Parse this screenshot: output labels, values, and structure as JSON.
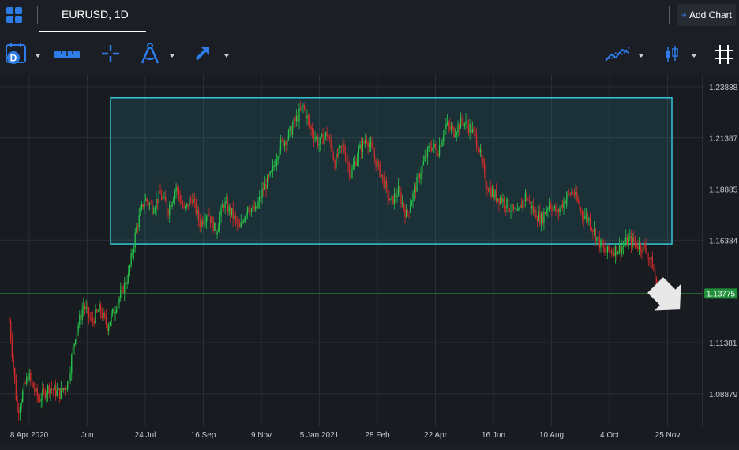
{
  "app": {
    "tab_title": "EURUSD, 1D",
    "add_chart_label": "Add Chart",
    "add_chart_plus": "+"
  },
  "toolbar": {
    "interval_badge": "D",
    "icons": [
      "calendar-interval-icon",
      "ruler-tool-icon",
      "crosshair-icon",
      "drawing-compass-icon",
      "arrow-tool-icon",
      "indicators-icon",
      "candle-type-icon",
      "grid-hash-icon"
    ]
  },
  "colors": {
    "up": "#26c44a",
    "down": "#d62b2b",
    "accent": "#2d7ce8",
    "rectangle": "#35c6d6",
    "price_line": "#2e8b3e",
    "price_label_bg": "#1f8f3a"
  },
  "chart_data": {
    "type": "candlestick",
    "symbol": "EURUSD",
    "interval": "1D",
    "y_ticks": [
      "1.23888",
      "1.21387",
      "1.18885",
      "1.16384",
      "1.13775",
      "1.11381",
      "1.08879"
    ],
    "x_ticks": [
      "8 Apr 2020",
      "Jun",
      "24 Jul",
      "16 Sep",
      "9 Nov",
      "5 Jan 2021",
      "28 Feb",
      "22 Apr",
      "16 Jun",
      "10 Aug",
      "4 Oct",
      "25 Nov"
    ],
    "ylim": [
      1.0729,
      1.2446
    ],
    "current_price": 1.13775,
    "current_price_label": "1.13775",
    "rectangle": {
      "y_top": 1.2335,
      "y_bottom": 1.162
    },
    "anchors": [
      [
        0,
        1.124
      ],
      [
        6,
        1.08
      ],
      [
        14,
        1.098
      ],
      [
        22,
        1.086
      ],
      [
        30,
        1.092
      ],
      [
        38,
        1.089
      ],
      [
        44,
        1.094
      ],
      [
        50,
        1.118
      ],
      [
        56,
        1.132
      ],
      [
        62,
        1.124
      ],
      [
        68,
        1.13
      ],
      [
        74,
        1.122
      ],
      [
        82,
        1.134
      ],
      [
        90,
        1.147
      ],
      [
        96,
        1.17
      ],
      [
        102,
        1.184
      ],
      [
        108,
        1.18
      ],
      [
        114,
        1.186
      ],
      [
        120,
        1.179
      ],
      [
        126,
        1.19
      ],
      [
        132,
        1.178
      ],
      [
        138,
        1.185
      ],
      [
        144,
        1.172
      ],
      [
        150,
        1.178
      ],
      [
        156,
        1.168
      ],
      [
        162,
        1.182
      ],
      [
        168,
        1.177
      ],
      [
        174,
        1.169
      ],
      [
        180,
        1.181
      ],
      [
        186,
        1.178
      ],
      [
        192,
        1.189
      ],
      [
        198,
        1.196
      ],
      [
        204,
        1.21
      ],
      [
        210,
        1.214
      ],
      [
        216,
        1.222
      ],
      [
        222,
        1.229
      ],
      [
        228,
        1.218
      ],
      [
        234,
        1.211
      ],
      [
        240,
        1.216
      ],
      [
        246,
        1.202
      ],
      [
        252,
        1.21
      ],
      [
        258,
        1.196
      ],
      [
        264,
        1.207
      ],
      [
        270,
        1.214
      ],
      [
        276,
        1.204
      ],
      [
        282,
        1.194
      ],
      [
        288,
        1.182
      ],
      [
        294,
        1.188
      ],
      [
        300,
        1.176
      ],
      [
        306,
        1.188
      ],
      [
        312,
        1.2
      ],
      [
        318,
        1.21
      ],
      [
        324,
        1.208
      ],
      [
        330,
        1.22
      ],
      [
        336,
        1.217
      ],
      [
        342,
        1.222
      ],
      [
        348,
        1.219
      ],
      [
        354,
        1.212
      ],
      [
        360,
        1.192
      ],
      [
        366,
        1.186
      ],
      [
        372,
        1.184
      ],
      [
        378,
        1.18
      ],
      [
        384,
        1.176
      ],
      [
        390,
        1.186
      ],
      [
        396,
        1.178
      ],
      [
        402,
        1.174
      ],
      [
        408,
        1.182
      ],
      [
        414,
        1.177
      ],
      [
        420,
        1.184
      ],
      [
        426,
        1.188
      ],
      [
        432,
        1.178
      ],
      [
        438,
        1.174
      ],
      [
        444,
        1.165
      ],
      [
        450,
        1.158
      ],
      [
        456,
        1.159
      ],
      [
        462,
        1.16
      ],
      [
        468,
        1.164
      ],
      [
        474,
        1.162
      ],
      [
        480,
        1.16
      ],
      [
        486,
        1.152
      ],
      [
        490,
        1.139
      ]
    ]
  }
}
